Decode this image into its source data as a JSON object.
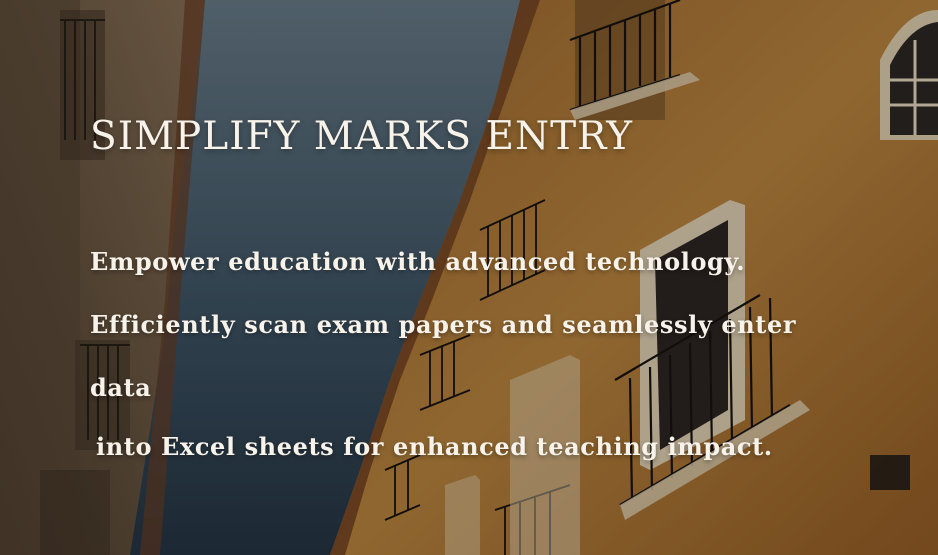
{
  "hero": {
    "title": "SIMPLIFY MARKS ENTRY",
    "description_lines": [
      "Empower education with advanced technology.",
      "Efficiently scan exam papers and seamlessly enter",
      "data",
      "into Excel sheets for enhanced teaching impact."
    ]
  },
  "colors": {
    "text": "#f8f3ea",
    "sky_top": "#5d7384",
    "sky_bottom": "#2f4657",
    "facade_left": "#7a6040",
    "facade_right": "#c98f3f"
  }
}
